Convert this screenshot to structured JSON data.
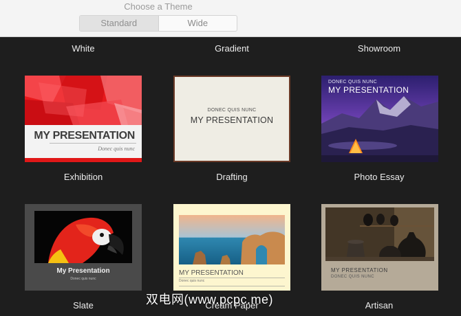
{
  "header": {
    "title": "Choose a Theme",
    "segments": {
      "standard": "Standard",
      "wide": "Wide"
    }
  },
  "row0": {
    "white": "White",
    "gradient": "Gradient",
    "showroom": "Showroom"
  },
  "themes": [
    {
      "name": "Exhibition",
      "title": "MY PRESENTATION",
      "subtitle": "Donec quis nunc"
    },
    {
      "name": "Drafting",
      "title": "MY PRESENTATION",
      "subtitle": "DONEC QUIS NUNC"
    },
    {
      "name": "Photo Essay",
      "title": "MY PRESENTATION",
      "subtitle": "DONEC QUIS NUNC"
    },
    {
      "name": "Slate",
      "title": "My Presentation",
      "subtitle": "Donec quis nunc"
    },
    {
      "name": "Cream Paper",
      "title": "MY PRESENTATION",
      "subtitle": "Donec quis nunc"
    },
    {
      "name": "Artisan",
      "title": "MY PRESENTATION",
      "subtitle": "DONEC QUIS NUNC"
    }
  ],
  "watermark": "双电网(www.pcpc.me)"
}
